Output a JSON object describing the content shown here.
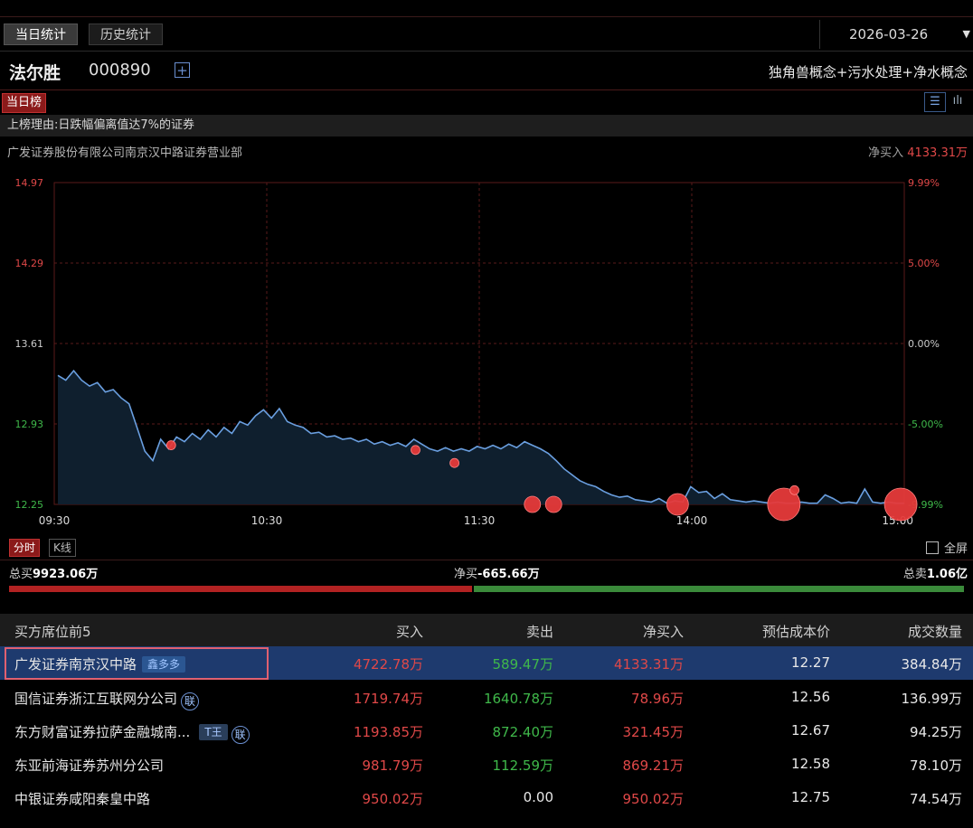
{
  "tabs": [
    {
      "label": "当日统计",
      "active": true
    },
    {
      "label": "历史统计",
      "active": false
    }
  ],
  "date": "2026-03-26",
  "stock": {
    "name": "法尔胜",
    "code": "000890",
    "concepts": "独角兽概念+污水处理+净水概念"
  },
  "list_tag": "当日榜",
  "reason": "上榜理由:日跌幅偏离值达7%的证券",
  "broker": {
    "title": "广发证券股份有限公司南京汉中路证券营业部",
    "net_label": "净买入",
    "net_value": "4133.31万"
  },
  "chart_data": {
    "type": "line",
    "y_left_ticks": [
      "14.97",
      "14.29",
      "13.61",
      "12.93",
      "12.25"
    ],
    "y_right_ticks": [
      "9.99%",
      "5.00%",
      "0.00%",
      "-5.00%",
      "-9.99%"
    ],
    "x_ticks": [
      "09:30",
      "10:30",
      "11:30",
      "14:00",
      "15:00"
    ],
    "ylim": [
      12.25,
      14.97
    ],
    "series": [
      {
        "values": [
          13.34,
          13.3,
          13.38,
          13.3,
          13.25,
          13.28,
          13.2,
          13.22,
          13.15,
          13.1,
          12.9,
          12.7,
          12.62,
          12.8,
          12.72,
          12.82,
          12.78,
          12.85,
          12.8,
          12.88,
          12.82,
          12.9,
          12.85,
          12.95,
          12.92,
          13.0,
          13.05,
          12.98,
          13.06,
          12.95,
          12.92,
          12.9,
          12.85,
          12.86,
          12.82,
          12.83,
          12.8,
          12.81,
          12.78,
          12.8,
          12.76,
          12.78,
          12.75,
          12.77,
          12.74,
          12.8,
          12.76,
          12.72,
          12.7,
          12.73,
          12.7,
          12.72,
          12.7,
          12.74,
          12.72,
          12.75,
          12.72,
          12.76,
          12.73,
          12.78,
          12.75,
          12.72,
          12.68,
          12.62,
          12.55,
          12.5,
          12.45,
          12.42,
          12.4,
          12.36,
          12.33,
          12.31,
          12.32,
          12.29,
          12.28,
          12.27,
          12.3,
          12.26,
          12.28,
          12.27,
          12.4,
          12.35,
          12.36,
          12.3,
          12.34,
          12.29,
          12.28,
          12.27,
          12.28,
          12.27,
          12.26,
          12.27,
          12.26,
          12.26,
          12.27,
          12.26,
          12.26,
          12.33,
          12.3,
          12.26,
          12.27,
          12.26,
          12.38,
          12.27,
          12.26,
          12.27,
          12.26,
          12.26
        ]
      }
    ],
    "markers": [
      {
        "time": "10:03",
        "price": 12.75,
        "size": "small"
      },
      {
        "time": "11:12",
        "price": 12.71,
        "size": "small"
      },
      {
        "time": "11:23",
        "price": 12.6,
        "size": "small"
      },
      {
        "time": "13:15",
        "price": 12.25,
        "size": "medium"
      },
      {
        "time": "13:21",
        "price": 12.25,
        "size": "medium"
      },
      {
        "time": "13:56",
        "price": 12.25,
        "size": "large"
      },
      {
        "time": "14:26",
        "price": 12.25,
        "size": "xlarge"
      },
      {
        "time": "14:29",
        "price": 12.37,
        "size": "small"
      },
      {
        "time": "14:59",
        "price": 12.25,
        "size": "xlarge"
      }
    ]
  },
  "chart_tabs": [
    {
      "label": "分时",
      "active": true
    },
    {
      "label": "K线",
      "active": false
    }
  ],
  "fullscreen_label": "全屏",
  "totals": {
    "buy_label": "总买",
    "buy_value": "9923.06万",
    "net_label": "净买",
    "net_value": "-665.66万",
    "sell_label": "总卖",
    "sell_value": "1.06亿",
    "buy_fraction": 0.9035
  },
  "table": {
    "headers": [
      "买方席位前5",
      "买入",
      "卖出",
      "净买入",
      "预估成本价",
      "成交数量"
    ],
    "rows": [
      {
        "name": "广发证券南京汉中路",
        "badge": "鑫多多",
        "buy": "4722.78万",
        "sell": "589.47万",
        "net": "4133.31万",
        "cost": "12.27",
        "volume": "384.84万"
      },
      {
        "name": "国信证券浙江互联网分公司",
        "circle": "联",
        "buy": "1719.74万",
        "sell": "1640.78万",
        "net": "78.96万",
        "cost": "12.56",
        "volume": "136.99万"
      },
      {
        "name": "东方财富证券拉萨金融城南...",
        "badge": "T王",
        "circle": "联",
        "buy": "1193.85万",
        "sell": "872.40万",
        "net": "321.45万",
        "cost": "12.67",
        "volume": "94.25万"
      },
      {
        "name": "东亚前海证券苏州分公司",
        "buy": "981.79万",
        "sell": "112.59万",
        "net": "869.21万",
        "cost": "12.58",
        "volume": "78.10万"
      },
      {
        "name": "中银证券咸阳秦皇中路",
        "buy": "950.02万",
        "sell": "0.00",
        "net": "950.02万",
        "cost": "12.75",
        "volume": "74.54万"
      }
    ]
  }
}
